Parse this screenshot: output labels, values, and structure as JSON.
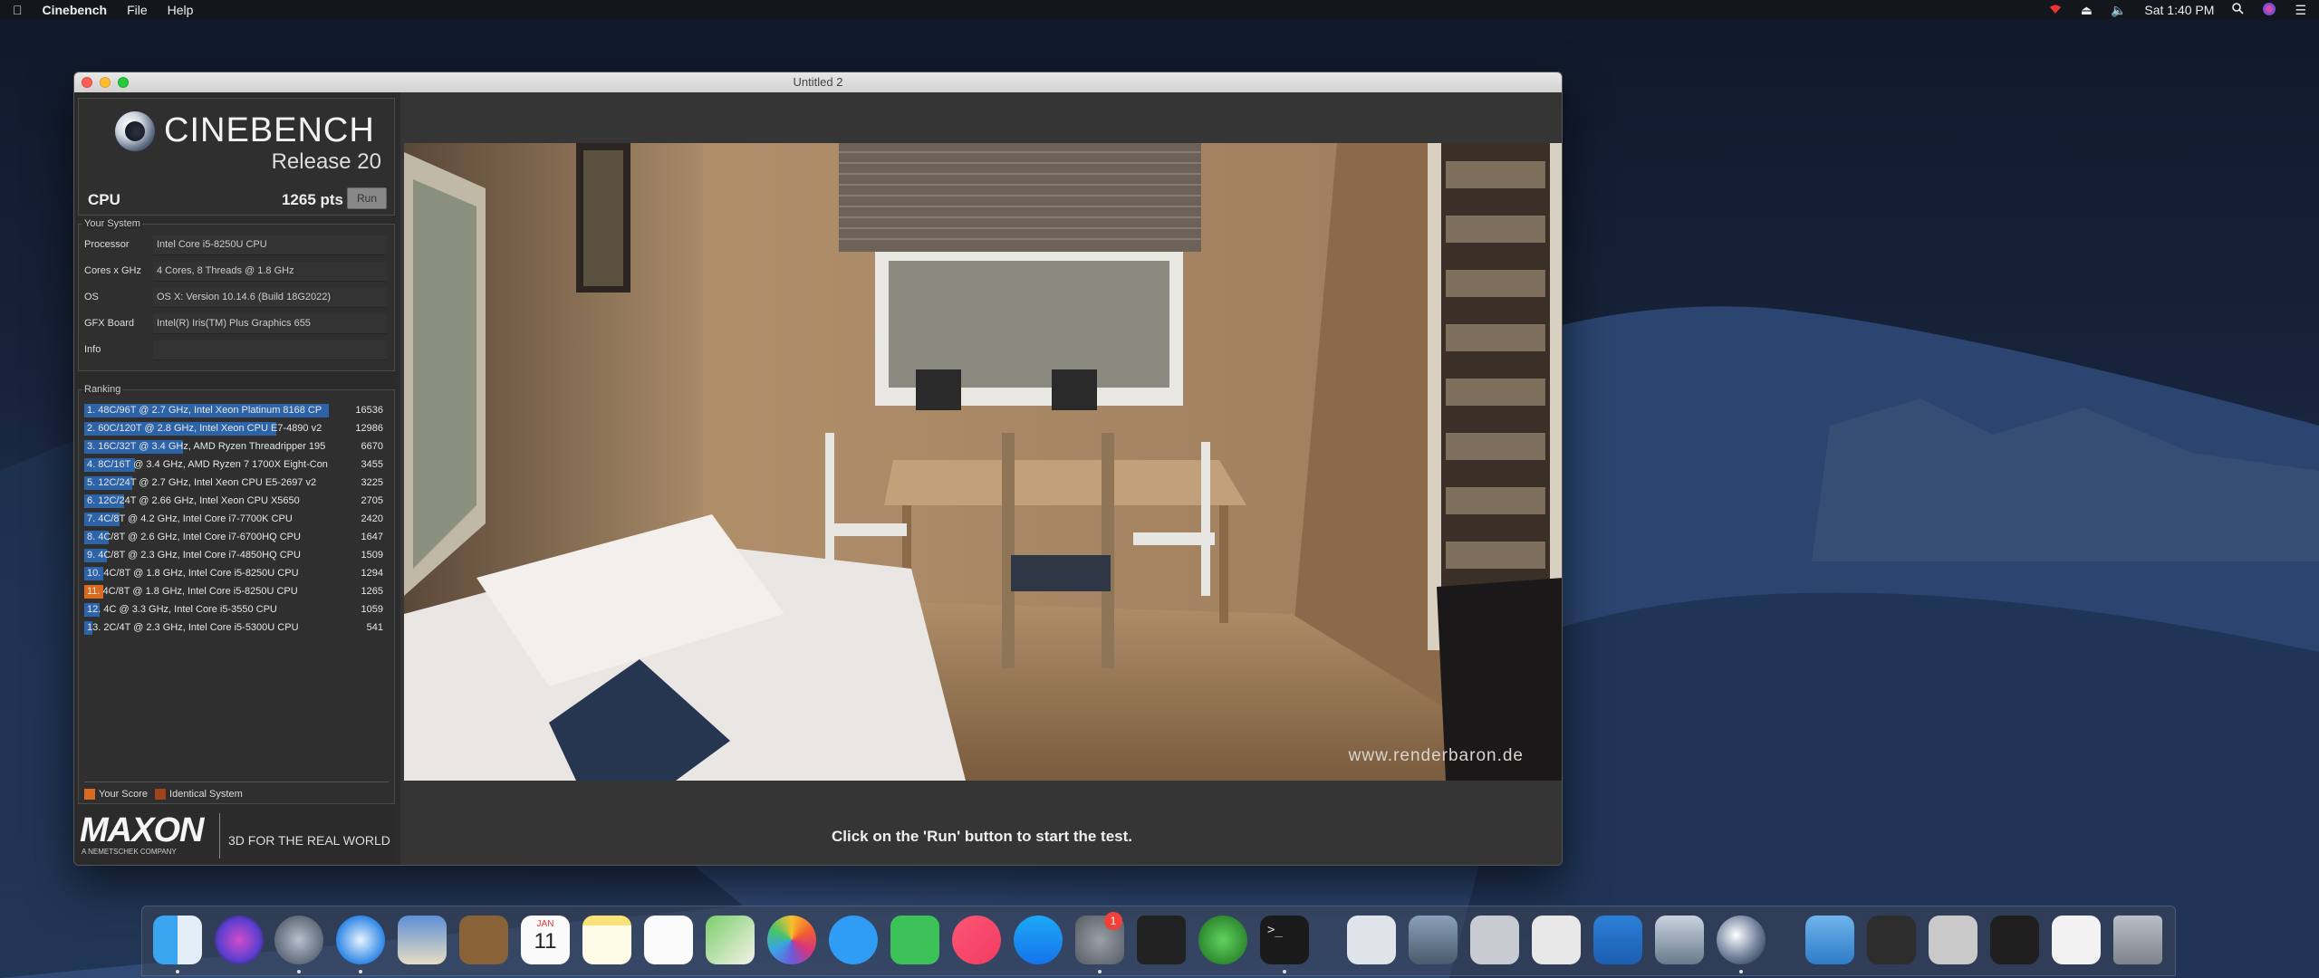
{
  "menubar": {
    "apple": "",
    "app_name": "Cinebench",
    "menus": [
      "File",
      "Help"
    ],
    "clock": "Sat 1:40 PM"
  },
  "window": {
    "title": "Untitled 2"
  },
  "cinebench": {
    "title": "CINEBENCH",
    "release": "Release 20",
    "cpu_label": "CPU",
    "cpu_score": "1265 pts",
    "run_label": "Run"
  },
  "your_system": {
    "legend": "Your System",
    "rows": [
      {
        "key": "Processor",
        "value": "Intel Core i5-8250U CPU"
      },
      {
        "key": "Cores x GHz",
        "value": "4 Cores, 8 Threads @ 1.8 GHz"
      },
      {
        "key": "OS",
        "value": "OS X: Version 10.14.6 (Build 18G2022)"
      },
      {
        "key": "GFX Board",
        "value": "Intel(R) Iris(TM) Plus Graphics 655"
      },
      {
        "key": "Info",
        "value": ""
      }
    ]
  },
  "ranking": {
    "legend": "Ranking",
    "rows": [
      {
        "label": "1. 48C/96T @ 2.7 GHz, Intel Xeon Platinum 8168 CP",
        "score": "16536",
        "fill": 1.0,
        "own": false
      },
      {
        "label": "2. 60C/120T @ 2.8 GHz, Intel Xeon CPU E7-4890 v2",
        "score": "12986",
        "fill": 0.785,
        "own": false
      },
      {
        "label": "3. 16C/32T @ 3.4 GHz, AMD Ryzen Threadripper 195",
        "score": "6670",
        "fill": 0.403,
        "own": false
      },
      {
        "label": "4. 8C/16T @ 3.4 GHz, AMD Ryzen 7 1700X Eight-Con",
        "score": "3455",
        "fill": 0.209,
        "own": false
      },
      {
        "label": "5. 12C/24T @ 2.7 GHz, Intel Xeon CPU E5-2697 v2",
        "score": "3225",
        "fill": 0.195,
        "own": false
      },
      {
        "label": "6. 12C/24T @ 2.66 GHz, Intel Xeon CPU X5650",
        "score": "2705",
        "fill": 0.164,
        "own": false
      },
      {
        "label": "7. 4C/8T @ 4.2 GHz, Intel Core i7-7700K CPU",
        "score": "2420",
        "fill": 0.146,
        "own": false
      },
      {
        "label": "8. 4C/8T @ 2.6 GHz, Intel Core i7-6700HQ CPU",
        "score": "1647",
        "fill": 0.1,
        "own": false
      },
      {
        "label": "9. 4C/8T @ 2.3 GHz, Intel Core i7-4850HQ CPU",
        "score": "1509",
        "fill": 0.091,
        "own": false
      },
      {
        "label": "10. 4C/8T @ 1.8 GHz, Intel Core i5-8250U CPU",
        "score": "1294",
        "fill": 0.078,
        "own": false
      },
      {
        "label": "11. 4C/8T @ 1.8 GHz, Intel Core i5-8250U CPU",
        "score": "1265",
        "fill": 0.076,
        "own": true
      },
      {
        "label": "12. 4C @ 3.3 GHz, Intel Core i5-3550 CPU",
        "score": "1059",
        "fill": 0.064,
        "own": false
      },
      {
        "label": "13. 2C/4T @ 2.3 GHz, Intel Core i5-5300U CPU",
        "score": "541",
        "fill": 0.033,
        "own": false
      }
    ],
    "legend_your_score": "Your Score",
    "legend_identical": "Identical System"
  },
  "maxon": {
    "logo": "MAXON",
    "sub": "A NEMETSCHEK COMPANY",
    "tagline": "3D FOR THE REAL WORLD"
  },
  "render": {
    "watermark": "www.renderbaron.de",
    "message": "Click on the 'Run' button to start the test."
  },
  "dock": {
    "badge": "1",
    "calendar_month": "JAN",
    "calendar_day": "11"
  },
  "colors": {
    "rank_bar": "#2d63a8",
    "own_score": "#d96a1e",
    "identical": "#a0451a"
  }
}
